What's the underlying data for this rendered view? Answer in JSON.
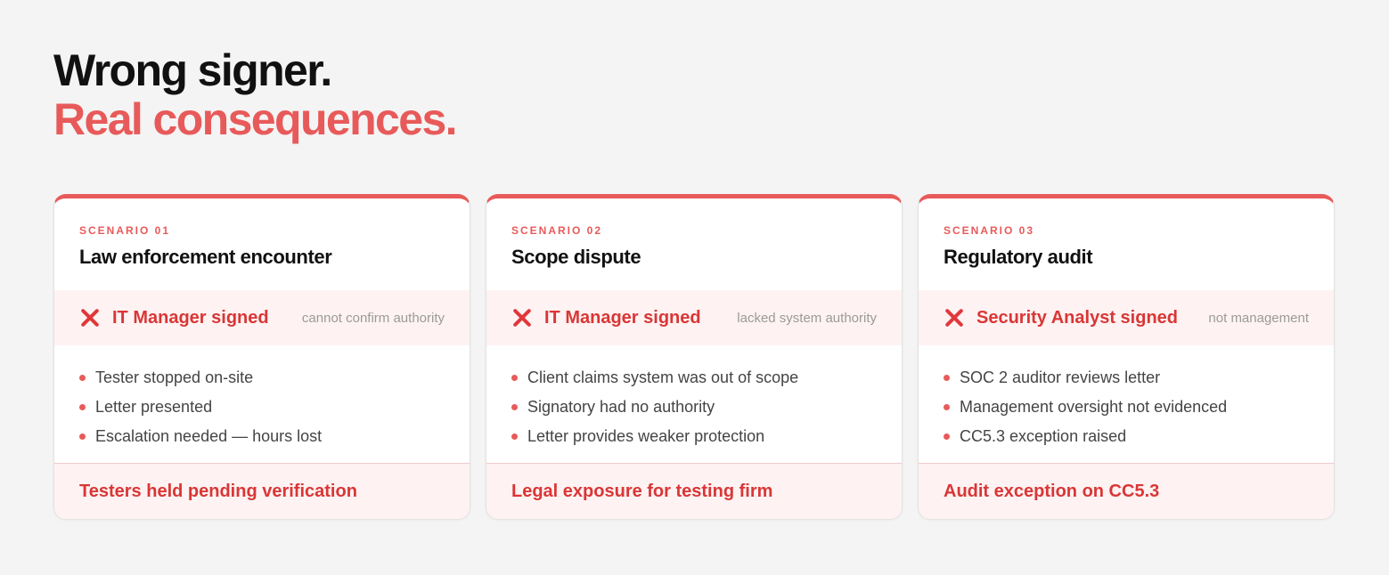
{
  "headline": {
    "line1": "Wrong signer.",
    "line2": "Real consequences."
  },
  "colors": {
    "accent": "#e85a5a",
    "accent_dark": "#d93636",
    "tint": "#fff2f2",
    "background": "#f4f4f4"
  },
  "cards": [
    {
      "label": "SCENARIO 01",
      "title": "Law enforcement encounter",
      "signer": "IT Manager signed",
      "note": "cannot confirm authority",
      "bullets": [
        "Tester stopped on-site",
        "Letter presented",
        "Escalation needed — hours lost"
      ],
      "footer": "Testers held pending verification"
    },
    {
      "label": "SCENARIO 02",
      "title": "Scope dispute",
      "signer": "IT Manager signed",
      "note": "lacked system authority",
      "bullets": [
        "Client claims system was out of scope",
        "Signatory had no authority",
        "Letter provides weaker protection"
      ],
      "footer": "Legal exposure for testing firm"
    },
    {
      "label": "SCENARIO 03",
      "title": "Regulatory audit",
      "signer": "Security Analyst signed",
      "note": "not management",
      "bullets": [
        "SOC 2 auditor reviews letter",
        "Management oversight not evidenced",
        "CC5.3 exception raised"
      ],
      "footer": "Audit exception on CC5.3"
    }
  ]
}
